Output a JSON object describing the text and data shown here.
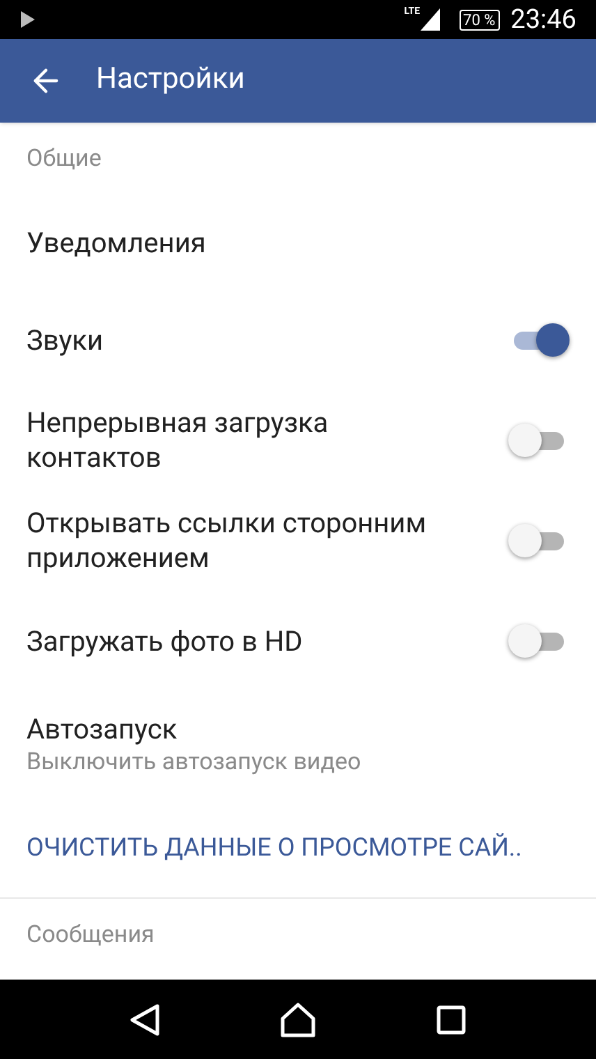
{
  "status_bar": {
    "network": "LTE",
    "battery": "70 %",
    "time": "23:46"
  },
  "app_bar": {
    "title": "Настройки"
  },
  "sections": [
    {
      "header": "Общие",
      "items": [
        {
          "kind": "plain",
          "title": "Уведомления"
        },
        {
          "kind": "toggle",
          "title": "Звуки",
          "on": true
        },
        {
          "kind": "toggle",
          "title": "Непрерывная загрузка контактов",
          "on": false
        },
        {
          "kind": "toggle",
          "title": "Открывать ссылки сторонним приложением",
          "on": false
        },
        {
          "kind": "toggle",
          "title": "Загружать фото в HD",
          "on": false
        },
        {
          "kind": "subtitle",
          "title": "Автозапуск",
          "subtitle": "Выключить автозапуск видео"
        },
        {
          "kind": "link",
          "title": "ОЧИСТИТЬ ДАННЫЕ О ПРОСМОТРЕ САЙ.."
        }
      ]
    },
    {
      "header": "Сообщения"
    }
  ]
}
